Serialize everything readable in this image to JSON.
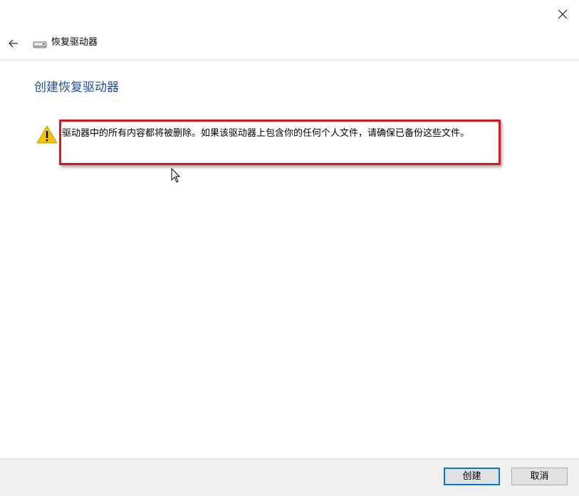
{
  "window": {
    "nav_title": "恢复驱动器"
  },
  "main": {
    "heading": "创建恢复驱动器",
    "warning": "驱动器中的所有内容都将被删除。如果该驱动器上包含你的任何个人文件，请确保已备份这些文件。"
  },
  "footer": {
    "create_label": "创建",
    "cancel_label": "取消"
  },
  "icons": {
    "close": "close-icon",
    "back": "back-arrow-icon",
    "drive": "drive-icon",
    "warning": "warning-icon",
    "cursor": "mouse-cursor-icon"
  },
  "colors": {
    "heading": "#1f4e9c",
    "highlight": "#e0151b",
    "warning_fill": "#f5c400",
    "primary_border": "#0078d7"
  }
}
